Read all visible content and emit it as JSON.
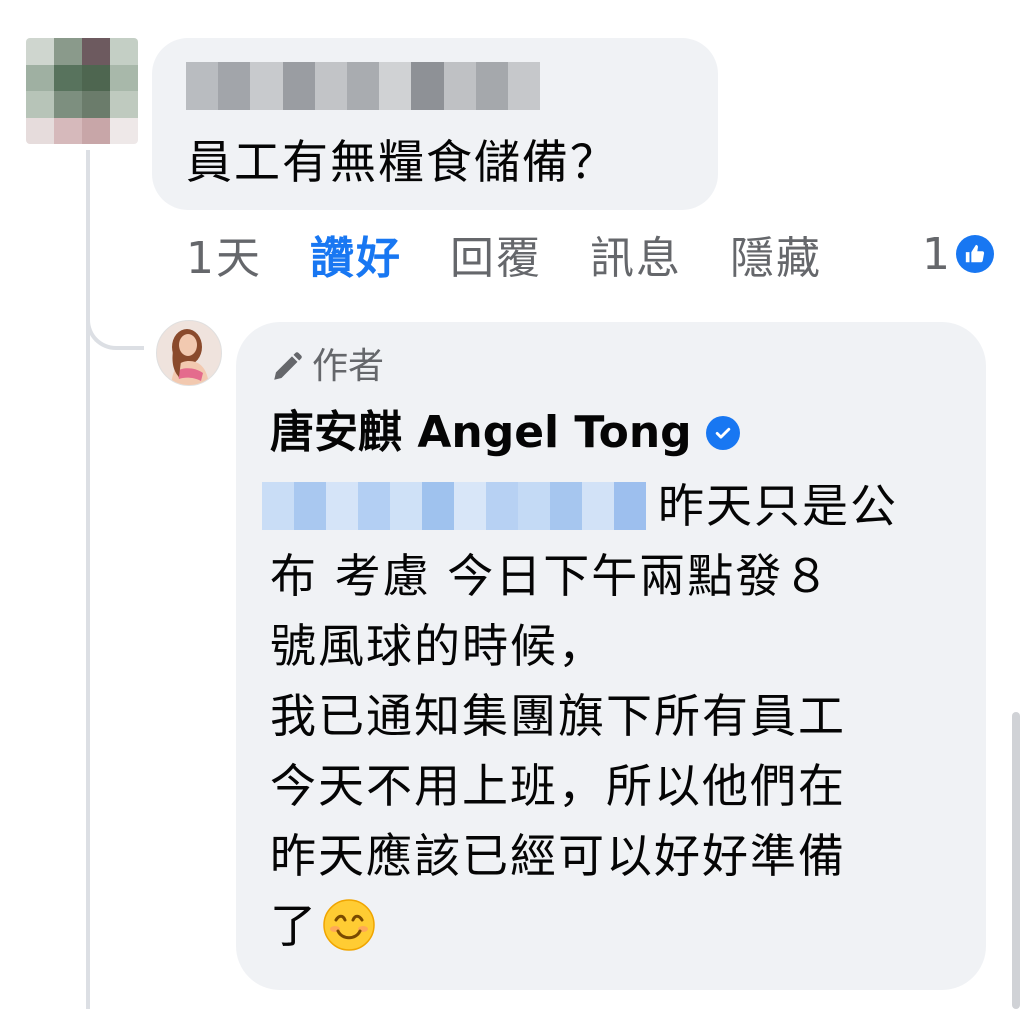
{
  "comment": {
    "text": "員工有無糧食儲備？",
    "age": "1天",
    "like_label": "讚好",
    "reply_label": "回覆",
    "message_label": "訊息",
    "hide_label": "隱藏",
    "reaction_count": "1"
  },
  "reply": {
    "badge_label": "作者",
    "author_name": "唐安麒 Angel Tong",
    "lines": [
      "昨天只是公",
      "布 考慮 今日下午兩點發８",
      "號風球的時候，",
      "我已通知集團旗下所有員工",
      "今天不用上班，所以他們在",
      "昨天應該已經可以好好準備",
      "了"
    ]
  },
  "colors": {
    "accent": "#1877f2",
    "bubble": "#f0f2f5",
    "secondary_text": "#65676b"
  },
  "icons": {
    "like": "thumbs-up-icon",
    "verified": "verified-badge-icon",
    "pencil": "pencil-icon",
    "emoji": "smiling-face-emoji"
  }
}
